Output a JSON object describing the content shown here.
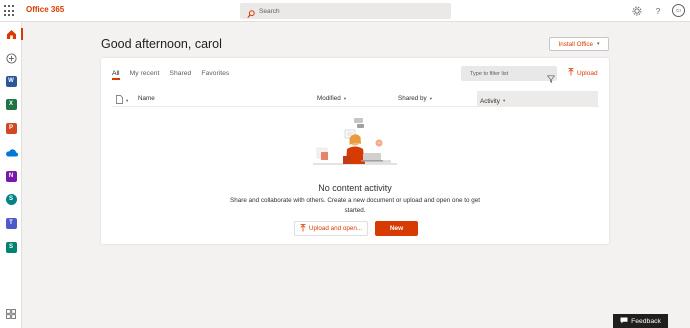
{
  "topbar": {
    "brand": "Office 365",
    "search_placeholder": "Search",
    "avatar_initials": "CI"
  },
  "rail": {
    "items": [
      {
        "name": "home",
        "color": "#d83b01"
      },
      {
        "name": "create",
        "color": "#605e5c"
      },
      {
        "name": "word",
        "letter": "W",
        "color": "#2b579a"
      },
      {
        "name": "excel",
        "letter": "X",
        "color": "#217346"
      },
      {
        "name": "powerpoint",
        "letter": "P",
        "color": "#d24726"
      },
      {
        "name": "onedrive",
        "color": "#0078d4"
      },
      {
        "name": "onenote",
        "letter": "N",
        "color": "#7719aa"
      },
      {
        "name": "sharepoint",
        "letter": "S",
        "color": "#038387"
      },
      {
        "name": "teams",
        "letter": "T",
        "color": "#5059c9"
      },
      {
        "name": "sway",
        "letter": "S",
        "color": "#008272"
      },
      {
        "name": "all-apps",
        "color": "#605e5c"
      }
    ]
  },
  "main": {
    "greeting": "Good afternoon, carol",
    "install_label": "Install Office",
    "tabs": [
      {
        "label": "All"
      },
      {
        "label": "My recent"
      },
      {
        "label": "Shared"
      },
      {
        "label": "Favorites"
      }
    ],
    "filter_placeholder": "Type to filter list",
    "upload_label": "Upload",
    "columns": {
      "name": "Name",
      "modified": "Modified",
      "shared_by": "Shared by",
      "activity": "Activity"
    },
    "empty_title": "No content activity",
    "empty_desc": "Share and collaborate with others. Create a new document or upload and open one to get started.",
    "upload_open_label": "Upload and open...",
    "new_label": "New"
  },
  "feedback_label": "Feedback",
  "colors": {
    "accent": "#d83b01",
    "background": "#f3f2f1"
  }
}
